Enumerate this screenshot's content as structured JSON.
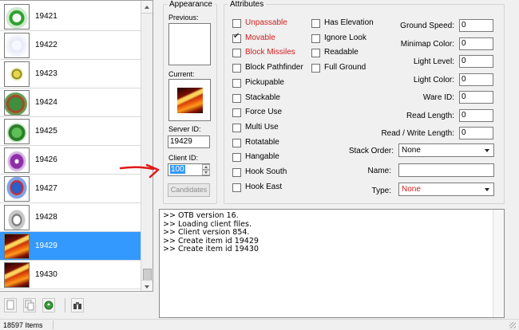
{
  "item_list": {
    "items": [
      {
        "id": "19421",
        "thumb": "green-ring",
        "selected": false
      },
      {
        "id": "19422",
        "thumb": "pale",
        "selected": false
      },
      {
        "id": "19423",
        "thumb": "coin",
        "selected": false
      },
      {
        "id": "19424",
        "thumb": "creature",
        "selected": false
      },
      {
        "id": "19425",
        "thumb": "plant",
        "selected": false
      },
      {
        "id": "19426",
        "thumb": "purple",
        "selected": false
      },
      {
        "id": "19427",
        "thumb": "blue",
        "selected": false
      },
      {
        "id": "19428",
        "thumb": "ghost",
        "selected": false
      },
      {
        "id": "19429",
        "thumb": "fire",
        "selected": true
      },
      {
        "id": "19430",
        "thumb": "fire",
        "selected": false
      }
    ]
  },
  "toolbar": {
    "icons": [
      "new-file-icon",
      "copy-icon",
      "reload-icon",
      "find-icon"
    ]
  },
  "appearance": {
    "legend": "Appearance",
    "previous_label": "Previous:",
    "current_label": "Current:",
    "server_id_label": "Server ID:",
    "server_id_value": "19429",
    "client_id_label": "Client ID:",
    "client_id_value": "100",
    "candidates_button": "Candidates"
  },
  "attributes": {
    "legend": "Attributes",
    "checkboxes_col1": [
      {
        "label": "Unpassable",
        "checked": false,
        "red": true
      },
      {
        "label": "Movable",
        "checked": true,
        "red": true
      },
      {
        "label": "Block Missiles",
        "checked": false,
        "red": true
      },
      {
        "label": "Block Pathfinder",
        "checked": false,
        "red": false
      },
      {
        "label": "Pickupable",
        "checked": false,
        "red": false
      },
      {
        "label": "Stackable",
        "checked": false,
        "red": false
      },
      {
        "label": "Force Use",
        "checked": false,
        "red": false
      },
      {
        "label": "Multi Use",
        "checked": false,
        "red": false
      },
      {
        "label": "Rotatable",
        "checked": false,
        "red": false
      },
      {
        "label": "Hangable",
        "checked": false,
        "red": false
      },
      {
        "label": "Hook South",
        "checked": false,
        "red": false
      },
      {
        "label": "Hook East",
        "checked": false,
        "red": false
      }
    ],
    "checkboxes_col2": [
      {
        "label": "Has Elevation",
        "checked": false
      },
      {
        "label": "Ignore Look",
        "checked": false
      },
      {
        "label": "Readable",
        "checked": false
      },
      {
        "label": "Full Ground",
        "checked": false
      }
    ],
    "fields": [
      {
        "label": "Ground Speed:",
        "value": "0"
      },
      {
        "label": "Minimap Color:",
        "value": "0"
      },
      {
        "label": "Light Level:",
        "value": "0"
      },
      {
        "label": "Light Color:",
        "value": "0"
      },
      {
        "label": "Ware ID:",
        "value": "0"
      },
      {
        "label": "Read Length:",
        "value": "0"
      },
      {
        "label": "Read / Write Length:",
        "value": "0"
      }
    ],
    "stack_order_label": "Stack Order:",
    "stack_order_value": "None",
    "name_label": "Name:",
    "name_value": "",
    "type_label": "Type:",
    "type_value": "None"
  },
  "log": {
    "lines": [
      ">> OTB version 16.",
      ">> Loading client files.",
      ">> Client version 854.",
      ">> Create item id 19429",
      ">> Create item id 19430"
    ]
  },
  "status_bar": {
    "item_count": "18597 Items"
  },
  "colors": {
    "selection": "#3399ff",
    "warning_label": "#d02020",
    "annotation_arrow": "#e01818"
  }
}
